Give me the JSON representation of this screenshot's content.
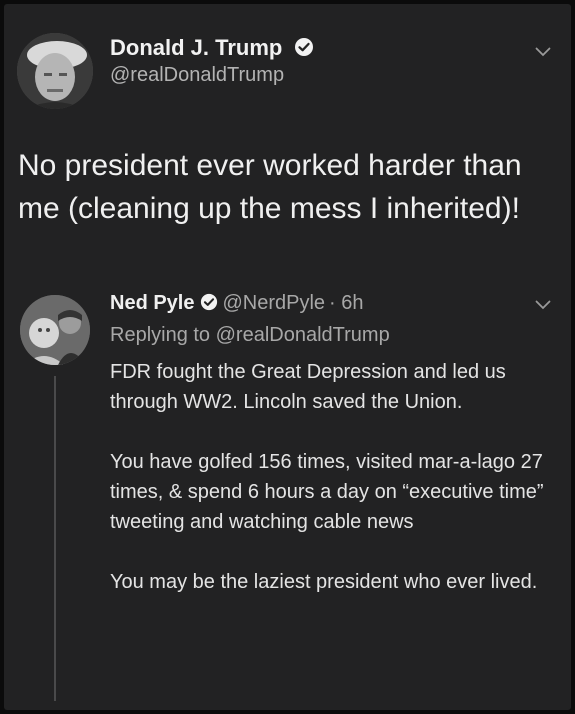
{
  "main_tweet": {
    "author_name": "Donald J. Trump",
    "handle": "@realDonaldTrump",
    "text": "No president ever worked harder than me (cleaning up the mess I inherited)!"
  },
  "reply_tweet": {
    "author_name": "Ned Pyle",
    "handle": "@NerdPyle",
    "time": "· 6h",
    "replying_to": "Replying to @realDonaldTrump",
    "paragraphs": [
      "FDR fought the Great Depression  and led us through WW2. Lincoln saved the Union.",
      "You have golfed 156 times, visited mar-a-lago 27 times, & spend 6 hours a day on “executive time” tweeting and watching cable news",
      "You may be the laziest president who ever lived."
    ]
  },
  "icons": {
    "verified": "verified-badge-icon",
    "menu": "chevron-down-icon"
  },
  "colors": {
    "background": "#222223",
    "text_primary": "#f0f0f0",
    "text_secondary": "#a8a8a8"
  }
}
